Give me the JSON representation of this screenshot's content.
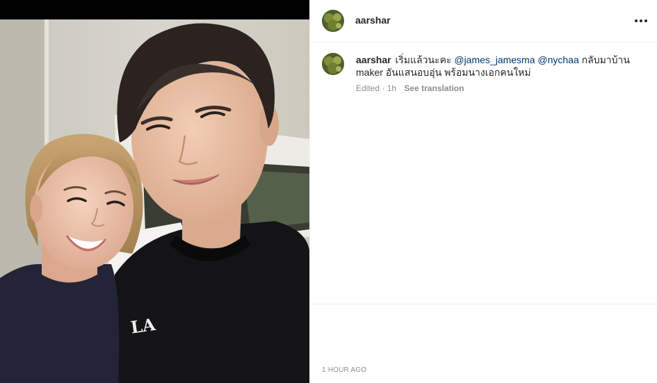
{
  "post": {
    "username": "aarshar",
    "more_icon": "more-horizontal-icon",
    "photo_alt": "Selfie of two people",
    "shirt_logo": "LA"
  },
  "caption": {
    "username": "aarshar",
    "text_start": "เริ่มแล้วนะคะ",
    "mention_1": "@james_jamesma",
    "mention_2": "@nychaa",
    "text_end": "กลับมาบ้าน maker อันแสนอบอุ่น พร้อมนางเอกคนใหม่",
    "edited": "Edited",
    "separator": "·",
    "age": "1h",
    "see_translation": "See translation"
  },
  "footer": {
    "timestamp": "1 HOUR AGO"
  },
  "colors": {
    "mention": "#00376b",
    "muted": "#8e8e8e",
    "text": "#262626",
    "divider": "#efefef"
  }
}
